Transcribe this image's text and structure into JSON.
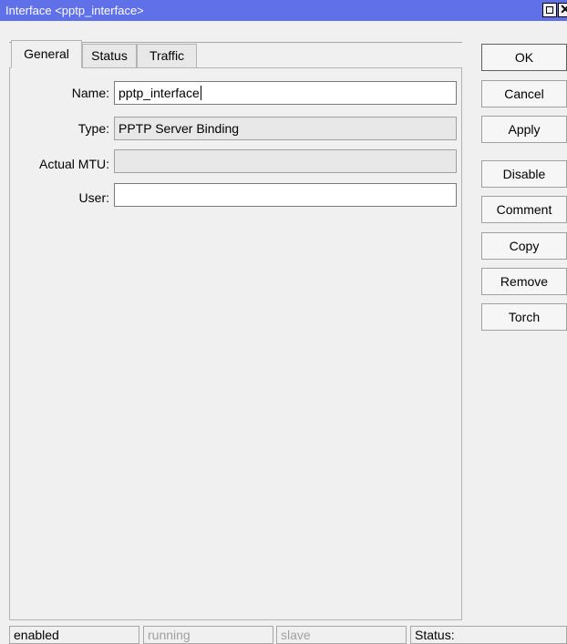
{
  "window": {
    "title": "Interface <pptp_interface>"
  },
  "tabs": [
    {
      "label": "General",
      "active": true
    },
    {
      "label": "Status",
      "active": false
    },
    {
      "label": "Traffic",
      "active": false
    }
  ],
  "form": {
    "name": {
      "label": "Name:",
      "value": "pptp_interface"
    },
    "type": {
      "label": "Type:",
      "value": "PPTP Server Binding"
    },
    "mtu": {
      "label": "Actual MTU:",
      "value": ""
    },
    "user": {
      "label": "User:",
      "value": ""
    }
  },
  "buttons": {
    "ok": "OK",
    "cancel": "Cancel",
    "apply": "Apply",
    "disable": "Disable",
    "comment": "Comment",
    "copy": "Copy",
    "remove": "Remove",
    "torch": "Torch"
  },
  "statusbar": {
    "enabled": "enabled",
    "running": "running",
    "slave": "slave",
    "status": "Status:"
  },
  "colors": {
    "titlebar": "#6070e8",
    "window_bg": "#f0f0f0",
    "dim_text": "#a0a0a0"
  }
}
